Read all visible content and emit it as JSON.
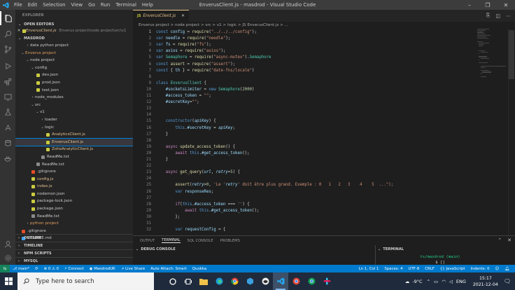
{
  "window": {
    "title": "EnverusClient.js - masdrod - Visual Studio Code",
    "menu": [
      "File",
      "Edit",
      "Selection",
      "View",
      "Go",
      "Run",
      "Terminal",
      "Help"
    ]
  },
  "sidebar": {
    "header": "EXPLORER",
    "open_editors_label": "OPEN EDITORS",
    "open_editor_file": "EnverusClient.js",
    "open_editor_path": "Enverus project\\node project\\src\\v1",
    "workspace_label": "MASDROD",
    "tree": [
      {
        "label": "data python project",
        "indent": 2,
        "kind": "folder",
        "open": false
      },
      {
        "label": "Enverus project",
        "indent": 1,
        "kind": "folder",
        "open": true,
        "orange": true
      },
      {
        "label": "node project",
        "indent": 2,
        "kind": "folder",
        "open": true
      },
      {
        "label": "config",
        "indent": 3,
        "kind": "folder",
        "open": true
      },
      {
        "label": "dev.json",
        "indent": 4,
        "kind": "json"
      },
      {
        "label": "prod.json",
        "indent": 4,
        "kind": "json"
      },
      {
        "label": "test.json",
        "indent": 4,
        "kind": "json"
      },
      {
        "label": "node_modules",
        "indent": 3,
        "kind": "folder",
        "open": false
      },
      {
        "label": "src",
        "indent": 3,
        "kind": "folder",
        "open": true
      },
      {
        "label": "v1",
        "indent": 4,
        "kind": "folder",
        "open": true
      },
      {
        "label": "loader",
        "indent": 5,
        "kind": "folder",
        "open": false
      },
      {
        "label": "logic",
        "indent": 5,
        "kind": "folder",
        "open": true
      },
      {
        "label": "AnalyticsClient.js",
        "indent": 6,
        "kind": "js"
      },
      {
        "label": "EnverusClient.js",
        "indent": 6,
        "kind": "js",
        "selected": true
      },
      {
        "label": "ZohoAnalyticClient.js",
        "indent": 6,
        "kind": "js"
      },
      {
        "label": "ReadMe.txt",
        "indent": 5,
        "kind": "txt"
      },
      {
        "label": "ReadMe.txt",
        "indent": 4,
        "kind": "txt"
      },
      {
        "label": ".gitignore",
        "indent": 3,
        "kind": "git"
      },
      {
        "label": "config.js",
        "indent": 3,
        "kind": "js"
      },
      {
        "label": "index.js",
        "indent": 3,
        "kind": "js"
      },
      {
        "label": "nodemon.json",
        "indent": 3,
        "kind": "json"
      },
      {
        "label": "package-lock.json",
        "indent": 3,
        "kind": "json"
      },
      {
        "label": "package.json",
        "indent": 3,
        "kind": "json"
      },
      {
        "label": "ReadMe.txt",
        "indent": 3,
        "kind": "txt"
      },
      {
        "label": "python project",
        "indent": 2,
        "kind": "folder",
        "open": false,
        "orange": true
      },
      {
        "label": ".gitignore",
        "indent": 1,
        "kind": "git"
      },
      {
        "label": "README.md",
        "indent": 1,
        "kind": "md"
      }
    ],
    "bottom_sections": [
      "OUTLINE",
      "TIMELINE",
      "NPM SCRIPTS",
      "MYSQL"
    ]
  },
  "editor": {
    "tab_label": "EnverusClient.js",
    "breadcrumb": "Enverus project > node project > src > v1 > logic > JS EnverusClient.js > ...",
    "line_numbers": [
      "1",
      "2",
      "3",
      "4",
      "5",
      "6",
      "7",
      "8",
      "9",
      "10",
      "11",
      "12",
      "13",
      "14",
      "15",
      "16",
      "17",
      "18",
      "19",
      "20",
      "21",
      "22",
      "23",
      "24",
      "25",
      "26",
      "27",
      "28",
      "29",
      "30",
      "31",
      "32"
    ],
    "lines": [
      "const config = require(\"../../../config\");",
      "var needle = require(\"needle\");",
      "var fs = require(\"fs\");",
      "var axios = require(\"axios\");",
      "var Semaphore = require(\"async-mutex\").Semaphore",
      "const assert = require(\"assert\");",
      "const { th } = require(\"date-fns/locale\")",
      "",
      "class EnverusClient {",
      "    #socketsLimiter = new Semaphore(2000)",
      "    #access_token = \"\";",
      "    #secretKey=\"\";",
      "",
      "",
      "    constructor(apiKey) {",
      "        this.#secretKey = apiKey;",
      "    }",
      "",
      "    async update_access_token() {",
      "        await this.#get_access_token();",
      "    }",
      "",
      "    async get_query(url, retry=5) {",
      "",
      "        assert(retry>0, 'Le 'retry' doit être plus grand. Exemple : 0   1   2   3    4    5  ...\");",
      "        var responseRes;",
      "",
      "        if(this.#access_token === '') {",
      "            await this.#get_access_token();",
      "        };",
      "",
      "        var requestConfig = {"
    ]
  },
  "panel": {
    "tabs": [
      "OUTPUT",
      "TERMINAL",
      "SQL CONSOLE",
      "PROBLEMS"
    ],
    "active_tab": "TERMINAL",
    "left_title": "DEBUG CONSOLE",
    "right_title": "TERMINAL",
    "terminal_line1": "ts/masdrod (main)",
    "terminal_prompt": "$ []"
  },
  "statusbar": {
    "branch": "main*",
    "errors": "⊗ 0 ⚠ 0",
    "connect": "Connect",
    "user": "MasdrodUK",
    "live_share": "Live Share",
    "autoattach": "Auto Attach: Smart",
    "quokka": "Quokka",
    "position": "Ln 1, Col 1",
    "spaces": "Spaces: 4",
    "encoding": "UTF-8",
    "eol": "CRLF",
    "language": "JavaScript",
    "indents": "Indents: 0"
  },
  "taskbar": {
    "search_placeholder": "Type here to search",
    "weather": "-9°C",
    "language": "ENG",
    "time": "15:17",
    "date": "2021-12-04"
  },
  "colors": {
    "accent": "#007acc",
    "modified_file": "#e2c08d",
    "folder_highlight": "#e2a05b"
  }
}
